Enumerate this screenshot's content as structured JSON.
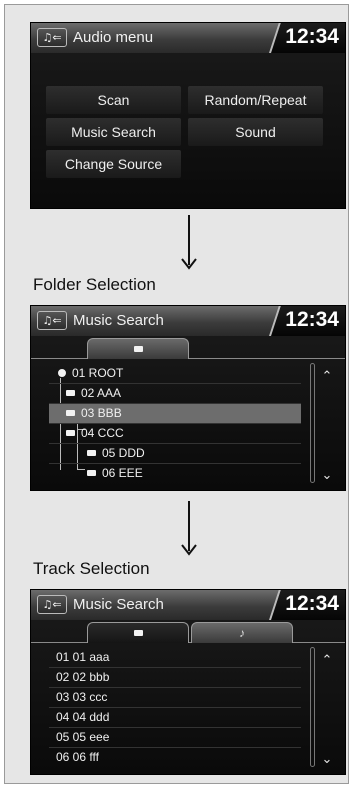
{
  "audio_menu": {
    "source_icon": "♫⇐",
    "title": "Audio menu",
    "clock": "12:34",
    "buttons": {
      "scan": "Scan",
      "random_repeat": "Random/Repeat",
      "music_search": "Music Search",
      "sound": "Sound",
      "change_source": "Change Source"
    }
  },
  "folder_section": {
    "heading": "Folder Selection",
    "screen": {
      "source_icon": "♫⇐",
      "title": "Music Search",
      "clock": "12:34",
      "tab_folder_icon": "folder-icon",
      "items": [
        "01 ROOT",
        "02 AAA",
        "03 BBB",
        "04 CCC",
        "05 DDD",
        "06 EEE"
      ],
      "selected_index": 2,
      "scroll_up": "⌃",
      "scroll_down": "⌄"
    }
  },
  "track_section": {
    "heading": "Track Selection",
    "screen": {
      "source_icon": "♫⇐",
      "title": "Music Search",
      "clock": "12:34",
      "tab_music": "♪",
      "tracks": [
        "01 01 aaa",
        "02 02 bbb",
        "03 03 ccc",
        "04 04 ddd",
        "05 05 eee",
        "06 06 fff"
      ],
      "scroll_up": "⌃",
      "scroll_down": "⌄"
    }
  },
  "colors": {
    "screen_bg": "#101010",
    "header": "#4a4a4a",
    "selected_row": "#6d6d6d",
    "frame_bg": "#e6e6e6"
  }
}
